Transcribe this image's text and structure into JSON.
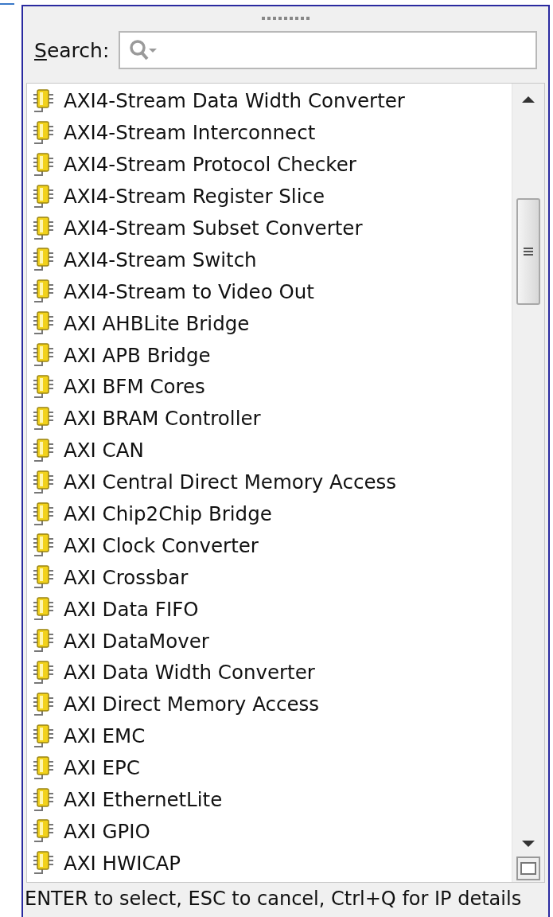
{
  "search": {
    "label": "Search:"
  },
  "items": [
    "AXI4-Stream Data Width Converter",
    "AXI4-Stream Interconnect",
    "AXI4-Stream Protocol Checker",
    "AXI4-Stream Register Slice",
    "AXI4-Stream Subset Converter",
    "AXI4-Stream Switch",
    "AXI4-Stream to Video Out",
    "AXI AHBLite Bridge",
    "AXI APB Bridge",
    "AXI BFM Cores",
    "AXI BRAM Controller",
    "AXI CAN",
    "AXI Central Direct Memory Access",
    "AXI Chip2Chip Bridge",
    "AXI Clock Converter",
    "AXI Crossbar",
    "AXI Data FIFO",
    "AXI DataMover",
    "AXI Data Width Converter",
    "AXI Direct Memory Access",
    "AXI EMC",
    "AXI EPC",
    "AXI EthernetLite",
    "AXI GPIO",
    "AXI HWICAP"
  ],
  "status_bar": "ENTER to select, ESC to cancel, Ctrl+Q for IP details"
}
